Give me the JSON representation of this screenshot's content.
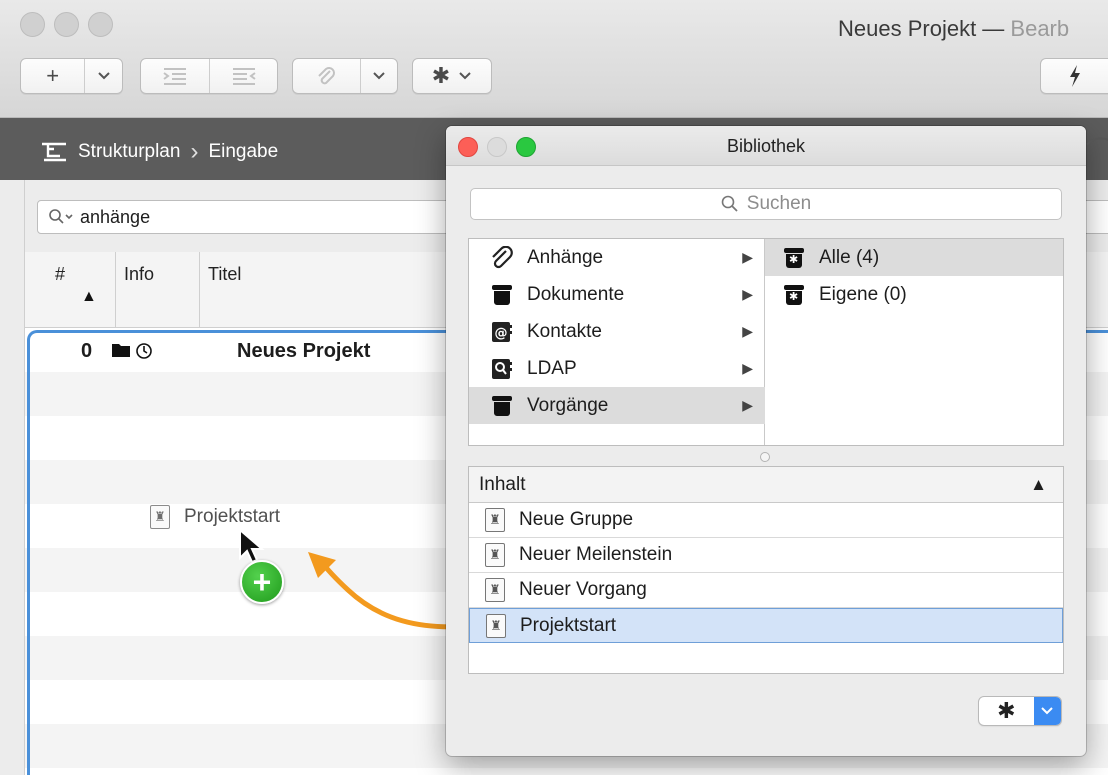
{
  "window": {
    "title_main": "Neues Projekt — ",
    "title_fade": "Bearb"
  },
  "toolbar": {
    "add_icon": "+",
    "chevron": "⌄",
    "indent_icon": "indent-icon",
    "outdent_icon": "outdent-icon",
    "attach_icon": "paperclip-icon",
    "gear_icon": "gear-icon",
    "flash_icon": "lightning-icon"
  },
  "breadcrumb": {
    "view": "Strukturplan",
    "mode": "Eingabe"
  },
  "outline": {
    "search_value": "anhänge",
    "columns": [
      "#",
      "Info",
      "Titel"
    ],
    "project_row": {
      "number": "0",
      "title": "Neues Projekt"
    },
    "drag_item": "Projektstart"
  },
  "library": {
    "title": "Bibliothek",
    "search_placeholder": "Suchen",
    "categories": [
      {
        "label": "Anhänge",
        "icon": "paperclip-icon"
      },
      {
        "label": "Dokumente",
        "icon": "bucket-icon"
      },
      {
        "label": "Kontakte",
        "icon": "at-book-icon"
      },
      {
        "label": "LDAP",
        "icon": "search-book-icon"
      },
      {
        "label": "Vorgänge",
        "icon": "bucket-icon"
      }
    ],
    "subcategories": [
      {
        "label": "Alle (4)",
        "icon": "bucket-gear-icon"
      },
      {
        "label": "Eigene (0)",
        "icon": "bucket-gear-icon"
      }
    ],
    "list_header": "Inhalt",
    "items": [
      "Neue Gruppe",
      "Neuer Meilenstein",
      "Neuer Vorgang",
      "Projektstart"
    ],
    "selected_item": "Projektstart"
  },
  "colors": {
    "accent": "#4a90d9",
    "drag_arrow": "#f39a1e",
    "add_badge": "#2fb32a",
    "popup_blue": "#3b8bf2"
  }
}
